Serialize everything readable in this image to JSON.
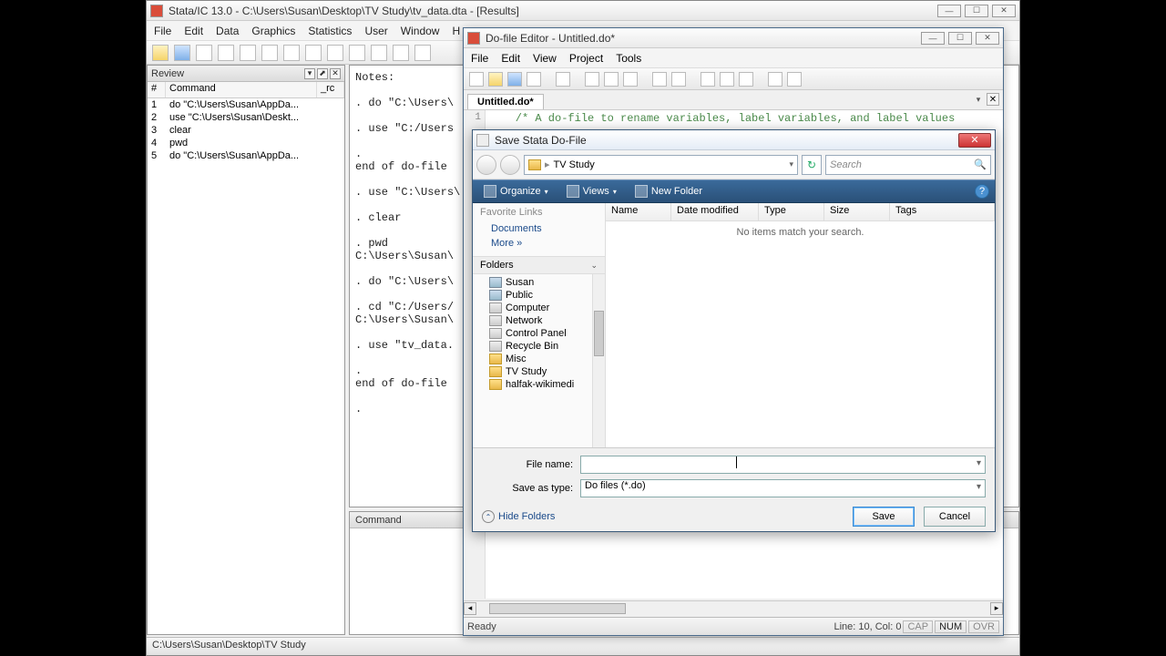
{
  "stata": {
    "title": "Stata/IC 13.0 - C:\\Users\\Susan\\Desktop\\TV Study\\tv_data.dta - [Results]",
    "menu": [
      "File",
      "Edit",
      "Data",
      "Graphics",
      "Statistics",
      "User",
      "Window",
      "H"
    ],
    "status": "C:\\Users\\Susan\\Desktop\\TV Study"
  },
  "review": {
    "title": "Review",
    "cols": {
      "num": "#",
      "cmd": "Command",
      "rc": "_rc"
    },
    "rows": [
      {
        "n": "1",
        "cmd": "do \"C:\\Users\\Susan\\AppDa..."
      },
      {
        "n": "2",
        "cmd": "use \"C:\\Users\\Susan\\Deskt..."
      },
      {
        "n": "3",
        "cmd": "clear"
      },
      {
        "n": "4",
        "cmd": "pwd"
      },
      {
        "n": "5",
        "cmd": "do \"C:\\Users\\Susan\\AppDa..."
      }
    ]
  },
  "results": "Notes:\n\n. do \"C:\\Users\\\n\n. use \"C:/Users\n\n.\nend of do-file\n\n. use \"C:\\Users\\\n\n. clear\n\n. pwd\nC:\\Users\\Susan\\\n\n. do \"C:\\Users\\\n\n. cd \"C:/Users/\nC:\\Users\\Susan\\\n\n. use \"tv_data.\n\n.\nend of do-file\n\n.",
  "command": {
    "title": "Command"
  },
  "dofile": {
    "title": "Do-file Editor - Untitled.do*",
    "menu": [
      "File",
      "Edit",
      "View",
      "Project",
      "Tools"
    ],
    "tab": "Untitled.do*",
    "line1": "    /* A do-file to rename variables, label variables, and label values",
    "status_ready": "Ready",
    "status_loc": "Line: 10, Col: 0",
    "ind_cap": "CAP",
    "ind_num": "NUM",
    "ind_ovr": "OVR"
  },
  "save": {
    "title": "Save Stata Do-File",
    "breadcrumb": "TV Study",
    "search_placeholder": "Search",
    "toolbar": {
      "organize": "Organize",
      "views": "Views",
      "newfolder": "New Folder"
    },
    "fav_head": "Favorite Links",
    "fav_items": [
      "Documents"
    ],
    "fav_more": "More  »",
    "folders_head": "Folders",
    "tree": [
      "Susan",
      "Public",
      "Computer",
      "Network",
      "Control Panel",
      "Recycle Bin",
      "Misc",
      "TV Study",
      "halfak-wikimedi"
    ],
    "list_cols": [
      "Name",
      "Date modified",
      "Type",
      "Size",
      "Tags"
    ],
    "list_empty": "No items match your search.",
    "filename_label": "File name:",
    "filename_value": "",
    "savetype_label": "Save as type:",
    "savetype_value": "Do files (*.do)",
    "hide_folders": "Hide Folders",
    "save_btn": "Save",
    "cancel_btn": "Cancel"
  },
  "status_indicators": {
    "cap": "CAP",
    "num": "NUM",
    "ovr": "OVR"
  }
}
